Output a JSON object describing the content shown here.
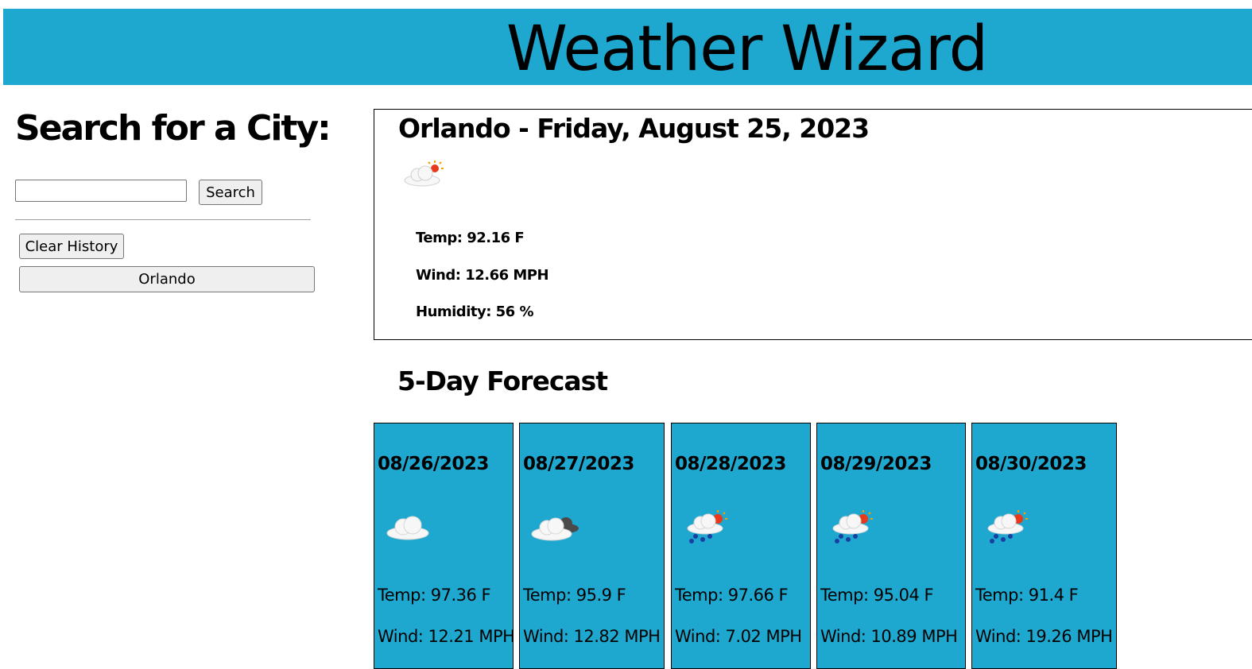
{
  "header": {
    "title": "Weather Wizard"
  },
  "sidebar": {
    "heading": "Search for a City:",
    "search_placeholder": "",
    "search_value": "",
    "search_button": "Search",
    "clear_button": "Clear History",
    "history": [
      "Orlando"
    ]
  },
  "current": {
    "title": "Orlando - Friday, August 25, 2023",
    "icon": "sun-behind-cloud-icon",
    "temp": "Temp: 92.16 F",
    "wind": "Wind: 12.66 MPH",
    "humidity": "Humidity: 56 %"
  },
  "forecast": {
    "heading": "5-Day Forecast",
    "days": [
      {
        "date": "08/26/2023",
        "icon": "cloud-icon",
        "temp": "Temp: 97.36 F",
        "wind": "Wind: 12.21 MPH"
      },
      {
        "date": "08/27/2023",
        "icon": "broken-clouds-icon",
        "temp": "Temp: 95.9 F",
        "wind": "Wind: 12.82 MPH"
      },
      {
        "date": "08/28/2023",
        "icon": "sun-rain-icon",
        "temp": "Temp: 97.66 F",
        "wind": "Wind: 7.02 MPH"
      },
      {
        "date": "08/29/2023",
        "icon": "sun-rain-icon",
        "temp": "Temp: 95.04 F",
        "wind": "Wind: 10.89 MPH"
      },
      {
        "date": "08/30/2023",
        "icon": "sun-rain-icon",
        "temp": "Temp: 91.4 F",
        "wind": "Wind: 19.26 MPH"
      }
    ]
  },
  "colors": {
    "accent": "#1ea8d0"
  }
}
